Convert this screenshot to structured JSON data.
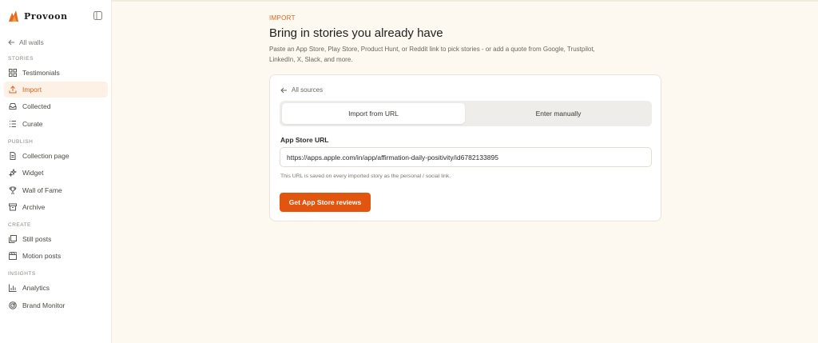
{
  "app": {
    "brand": "Provoon"
  },
  "sidebar": {
    "back_label": "All walls",
    "sections": [
      {
        "label": "STORIES",
        "items": [
          {
            "label": "Testimonials",
            "icon": "grid-icon"
          },
          {
            "label": "Import",
            "icon": "upload-icon",
            "active": true
          },
          {
            "label": "Collected",
            "icon": "inbox-icon"
          },
          {
            "label": "Curate",
            "icon": "list-icon"
          }
        ]
      },
      {
        "label": "PUBLISH",
        "items": [
          {
            "label": "Collection page",
            "icon": "document-icon"
          },
          {
            "label": "Widget",
            "icon": "sparkle-icon"
          },
          {
            "label": "Wall of Fame",
            "icon": "trophy-icon"
          },
          {
            "label": "Archive",
            "icon": "archive-icon"
          }
        ]
      },
      {
        "label": "CREATE",
        "items": [
          {
            "label": "Still posts",
            "icon": "image-stack-icon"
          },
          {
            "label": "Motion posts",
            "icon": "clapperboard-icon"
          }
        ]
      },
      {
        "label": "INSIGHTS",
        "items": [
          {
            "label": "Analytics",
            "icon": "bar-chart-icon"
          },
          {
            "label": "Brand Monitor",
            "icon": "radar-icon"
          }
        ]
      }
    ]
  },
  "main": {
    "kicker": "IMPORT",
    "title": "Bring in stories you already have",
    "description": "Paste an App Store, Play Store, Product Hunt, or Reddit link to pick stories - or add a quote from Google, Trustpilot, LinkedIn, X, Slack, and more."
  },
  "card": {
    "back_label": "All sources",
    "tabs": [
      {
        "label": "Import from URL",
        "active": true
      },
      {
        "label": "Enter manually",
        "active": false
      }
    ],
    "field_label": "App Store URL",
    "url_value": "https://apps.apple.com/in/app/affirmation-daily-positivity/id6782133895",
    "hint": "This URL is saved on every imported story as the personal / social link.",
    "submit_label": "Get App Store reviews"
  },
  "colors": {
    "accent": "#e2621a",
    "button": "#e2550f",
    "background": "#fdf9f1"
  }
}
